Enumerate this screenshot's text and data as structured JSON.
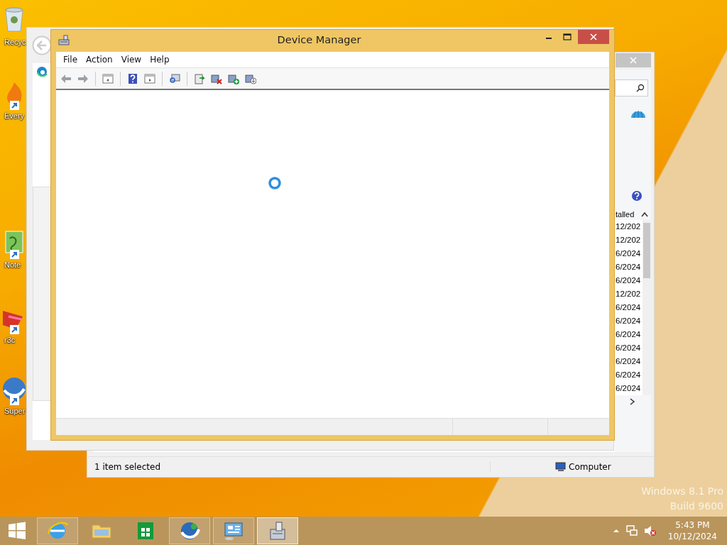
{
  "desktop_icons": [
    {
      "kind": "recycle-bin",
      "label": "Recyc"
    },
    {
      "kind": "flame",
      "label": "Every"
    },
    {
      "kind": "notepad",
      "label": "Note"
    },
    {
      "kind": "ribbon",
      "label": "r3c"
    },
    {
      "kind": "globe",
      "label": "Super"
    }
  ],
  "programs_window": {
    "column_header": "talled",
    "rows": [
      "12/202",
      "12/202",
      "6/2024",
      "6/2024",
      "6/2024",
      "12/202",
      "6/2024",
      "6/2024",
      "6/2024",
      "6/2024",
      "6/2024",
      "6/2024",
      "6/2024"
    ],
    "status_text": "1 item selected",
    "status_location": "Computer"
  },
  "device_manager": {
    "title": "Device Manager",
    "menu": [
      "File",
      "Action",
      "View",
      "Help"
    ],
    "loading": true
  },
  "system_watermark": [
    "Windows 8.1 Pro",
    "Build 9600"
  ],
  "taskbar": {
    "apps": [
      {
        "kind": "browser",
        "selected": false
      },
      {
        "kind": "folder",
        "selected": false
      },
      {
        "kind": "store",
        "selected": false
      },
      {
        "kind": "globe",
        "selected": false
      },
      {
        "kind": "control-panel",
        "selected": false
      },
      {
        "kind": "device-manager",
        "selected": true
      }
    ],
    "time": "5:43 PM",
    "date": "10/12/2024"
  }
}
